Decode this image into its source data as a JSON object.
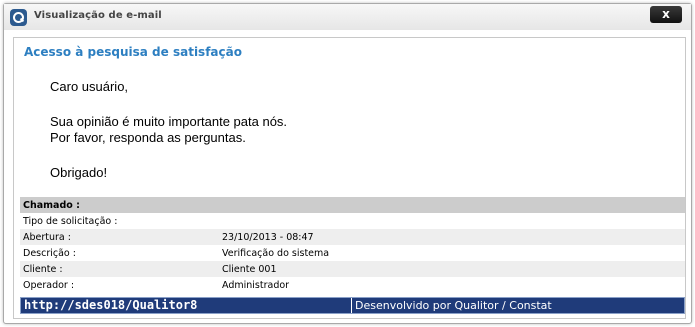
{
  "window": {
    "title": "Visualização de e-mail",
    "close_label": "x"
  },
  "email": {
    "subject": "Acesso à pesquisa de satisfação",
    "greeting": "Caro usuário,",
    "line1": "Sua opinião é muito importante pata nós.",
    "line2": "Por favor, responda as perguntas.",
    "closing": "Obrigado!"
  },
  "info": {
    "header": {
      "label": "Chamado :",
      "value": ""
    },
    "rows": [
      {
        "label": "Tipo de solicitação :",
        "value": ""
      },
      {
        "label": "Abertura :",
        "value": "23/10/2013 - 08:47"
      },
      {
        "label": "Descrição :",
        "value": "Verificação do sistema"
      },
      {
        "label": "Cliente :",
        "value": "Cliente 001"
      },
      {
        "label": "Operador :",
        "value": "Administrador"
      }
    ]
  },
  "footer": {
    "url": "http://sdes018/Qualitor8",
    "credit": "Desenvolvido por Qualitor / Constat"
  },
  "colors": {
    "subject": "#2d7fc1",
    "footer_bg": "#1f3b7a",
    "header_row": "#cccccc",
    "alt_row": "#eeeeee"
  }
}
